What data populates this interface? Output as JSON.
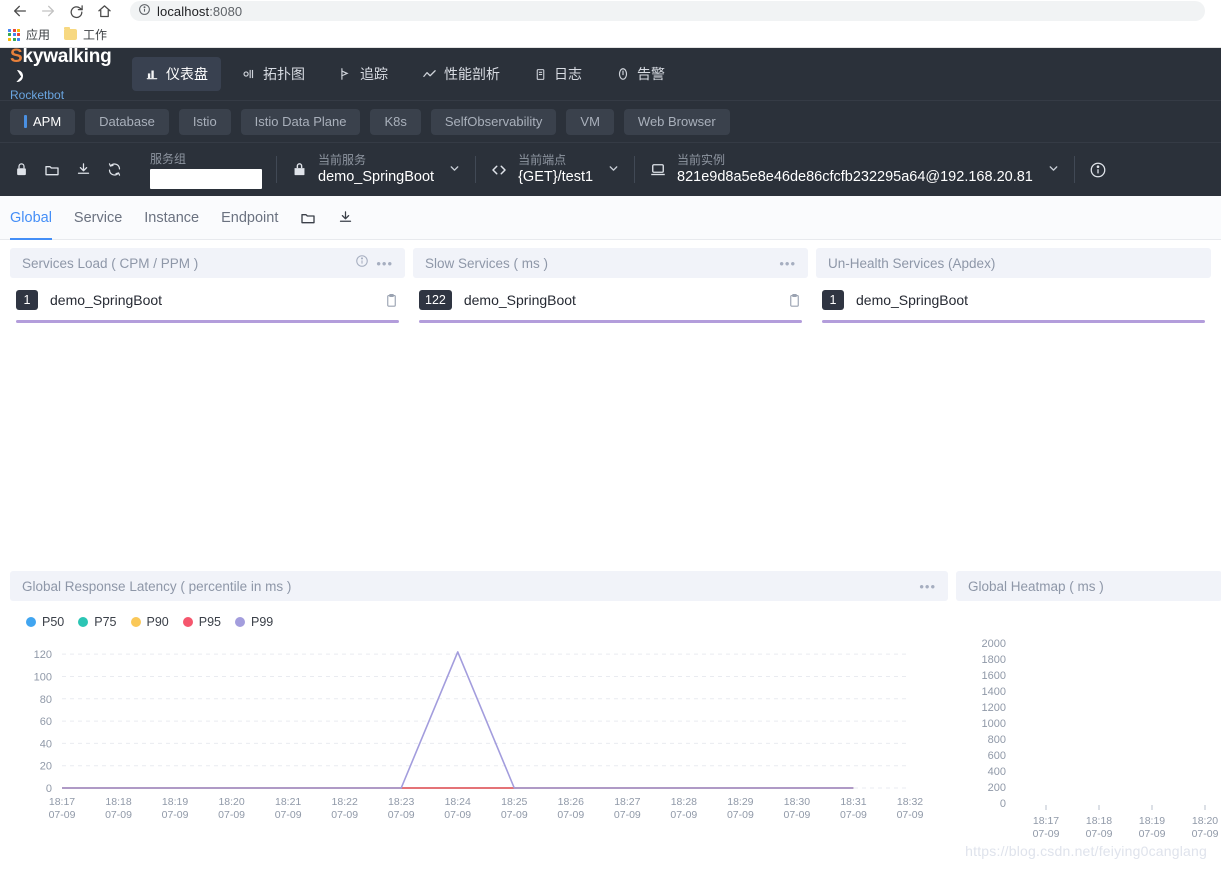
{
  "browser": {
    "back_icon": "arrow-left-icon",
    "forward_icon": "arrow-right-icon",
    "reload_icon": "reload-icon",
    "home_icon": "home-icon",
    "url_host": "localhost",
    "url_port": ":8080",
    "site_info_icon": "info-circle-icon",
    "bookmarks": [
      {
        "label": "应用",
        "icon": "apps-grid-icon"
      },
      {
        "label": "工作",
        "icon": "folder-icon"
      }
    ]
  },
  "header": {
    "logo_first": "S",
    "logo_rest": "kywalking",
    "logo_sub": "Rocketbot",
    "nav": [
      {
        "label": "仪表盘",
        "icon": "dashboard-icon",
        "active": true
      },
      {
        "label": "拓扑图",
        "icon": "topology-icon",
        "active": false
      },
      {
        "label": "追踪",
        "icon": "trace-icon",
        "active": false
      },
      {
        "label": "性能剖析",
        "icon": "profile-icon",
        "active": false
      },
      {
        "label": "日志",
        "icon": "log-icon",
        "active": false
      },
      {
        "label": "告警",
        "icon": "alarm-icon",
        "active": false
      }
    ]
  },
  "tabs": [
    {
      "label": "APM",
      "active": true
    },
    {
      "label": "Database",
      "active": false
    },
    {
      "label": "Istio",
      "active": false
    },
    {
      "label": "Istio Data Plane",
      "active": false
    },
    {
      "label": "K8s",
      "active": false
    },
    {
      "label": "SelfObservability",
      "active": false
    },
    {
      "label": "VM",
      "active": false
    },
    {
      "label": "Web Browser",
      "active": false
    }
  ],
  "selector": {
    "icons": [
      "lock-icon",
      "folder-icon",
      "download-icon",
      "refresh-icon"
    ],
    "group": {
      "label": "服务组",
      "value": "",
      "placeholder": ""
    },
    "service": {
      "label": "当前服务",
      "value": "demo_SpringBoot",
      "icon": "service-icon"
    },
    "endpoint": {
      "label": "当前端点",
      "value": "{GET}/test1",
      "icon": "code-icon"
    },
    "instance": {
      "label": "当前实例",
      "value": "821e9d8a5e8e46de86cfcfb232295a64@192.168.20.81",
      "icon": "instance-icon"
    },
    "info_icon": "info-circle-icon"
  },
  "subtabs": {
    "items": [
      {
        "label": "Global",
        "active": true
      },
      {
        "label": "Service",
        "active": false
      },
      {
        "label": "Instance",
        "active": false
      },
      {
        "label": "Endpoint",
        "active": false
      }
    ],
    "folder_icon": "folder-icon",
    "download_icon": "download-icon"
  },
  "cards": {
    "services_load": {
      "title": "Services Load ( CPM / PPM )",
      "has_info": true,
      "rows": [
        {
          "badge": "1",
          "name": "demo_SpringBoot",
          "bar_pct": 100
        }
      ]
    },
    "slow_services": {
      "title": "Slow Services ( ms )",
      "has_info": false,
      "rows": [
        {
          "badge": "122",
          "name": "demo_SpringBoot",
          "bar_pct": 100
        }
      ]
    },
    "unhealth_services": {
      "title": "Un-Health Services (Apdex)",
      "has_info": false,
      "rows": [
        {
          "badge": "1",
          "name": "demo_SpringBoot",
          "bar_pct": 100
        }
      ]
    },
    "latency": {
      "title": "Global Response Latency ( percentile in ms )",
      "has_info": false
    },
    "heatmap": {
      "title": "Global Heatmap ( ms )",
      "has_info": false
    }
  },
  "colors": {
    "p50": "#41a5f0",
    "p75": "#2bc5b4",
    "p90": "#fac858",
    "p95": "#f5566d",
    "p99": "#a39ddd",
    "accent_blue": "#448ef7",
    "bar_purple": "#b39ddb",
    "header_dark": "#2b313a"
  },
  "watermark": "https://blog.csdn.net/feiying0canglang",
  "chart_data": [
    {
      "type": "line",
      "title": "Global Response Latency ( percentile in ms )",
      "xlabel": "",
      "ylabel": "",
      "ylim": [
        0,
        130
      ],
      "yticks": [
        0,
        20,
        40,
        60,
        80,
        100,
        120
      ],
      "grid": true,
      "legend": [
        "P50",
        "P75",
        "P90",
        "P95",
        "P99"
      ],
      "legend_position": "top-left",
      "x": [
        "18:17\n07-09",
        "18:18\n07-09",
        "18:19\n07-09",
        "18:20\n07-09",
        "18:21\n07-09",
        "18:22\n07-09",
        "18:23\n07-09",
        "18:24\n07-09",
        "18:25\n07-09",
        "18:26\n07-09",
        "18:27\n07-09",
        "18:28\n07-09",
        "18:29\n07-09",
        "18:30\n07-09",
        "18:31\n07-09",
        "18:32\n07-09"
      ],
      "x_times": [
        "18:17",
        "18:18",
        "18:19",
        "18:20",
        "18:21",
        "18:22",
        "18:23",
        "18:24",
        "18:25",
        "18:26",
        "18:27",
        "18:28",
        "18:29",
        "18:30",
        "18:31",
        "18:32"
      ],
      "x_dates": [
        "07-09",
        "07-09",
        "07-09",
        "07-09",
        "07-09",
        "07-09",
        "07-09",
        "07-09",
        "07-09",
        "07-09",
        "07-09",
        "07-09",
        "07-09",
        "07-09",
        "07-09",
        "07-09"
      ],
      "series": [
        {
          "name": "P50",
          "color": "#41a5f0",
          "values": [
            0,
            0,
            0,
            0,
            0,
            0,
            0,
            0,
            0,
            0,
            0,
            0,
            0,
            0,
            0,
            null
          ]
        },
        {
          "name": "P75",
          "color": "#2bc5b4",
          "values": [
            0,
            0,
            0,
            0,
            0,
            0,
            0,
            0,
            0,
            0,
            0,
            0,
            0,
            0,
            0,
            null
          ]
        },
        {
          "name": "P90",
          "color": "#fac858",
          "values": [
            0,
            0,
            0,
            0,
            0,
            0,
            0,
            0,
            0,
            0,
            0,
            0,
            0,
            0,
            0,
            null
          ]
        },
        {
          "name": "P95",
          "color": "#f5566d",
          "values": [
            0,
            0,
            0,
            0,
            0,
            0,
            0,
            0,
            0,
            0,
            0,
            0,
            0,
            0,
            0,
            null
          ]
        },
        {
          "name": "P99",
          "color": "#a39ddd",
          "values": [
            0,
            0,
            0,
            0,
            0,
            0,
            0,
            122,
            0,
            0,
            0,
            0,
            0,
            0,
            0,
            null
          ]
        }
      ]
    },
    {
      "type": "heatmap",
      "title": "Global Heatmap ( ms )",
      "xlabel": "",
      "ylabel": "",
      "ylim": [
        0,
        2000
      ],
      "yticks": [
        0,
        200,
        400,
        600,
        800,
        1000,
        1200,
        1400,
        1600,
        1800,
        2000
      ],
      "grid": false,
      "x_times": [
        "18:17",
        "18:18",
        "18:19",
        "18:20"
      ],
      "x_dates": [
        "07-09",
        "07-09",
        "07-09",
        "07-09"
      ],
      "cells": []
    }
  ]
}
